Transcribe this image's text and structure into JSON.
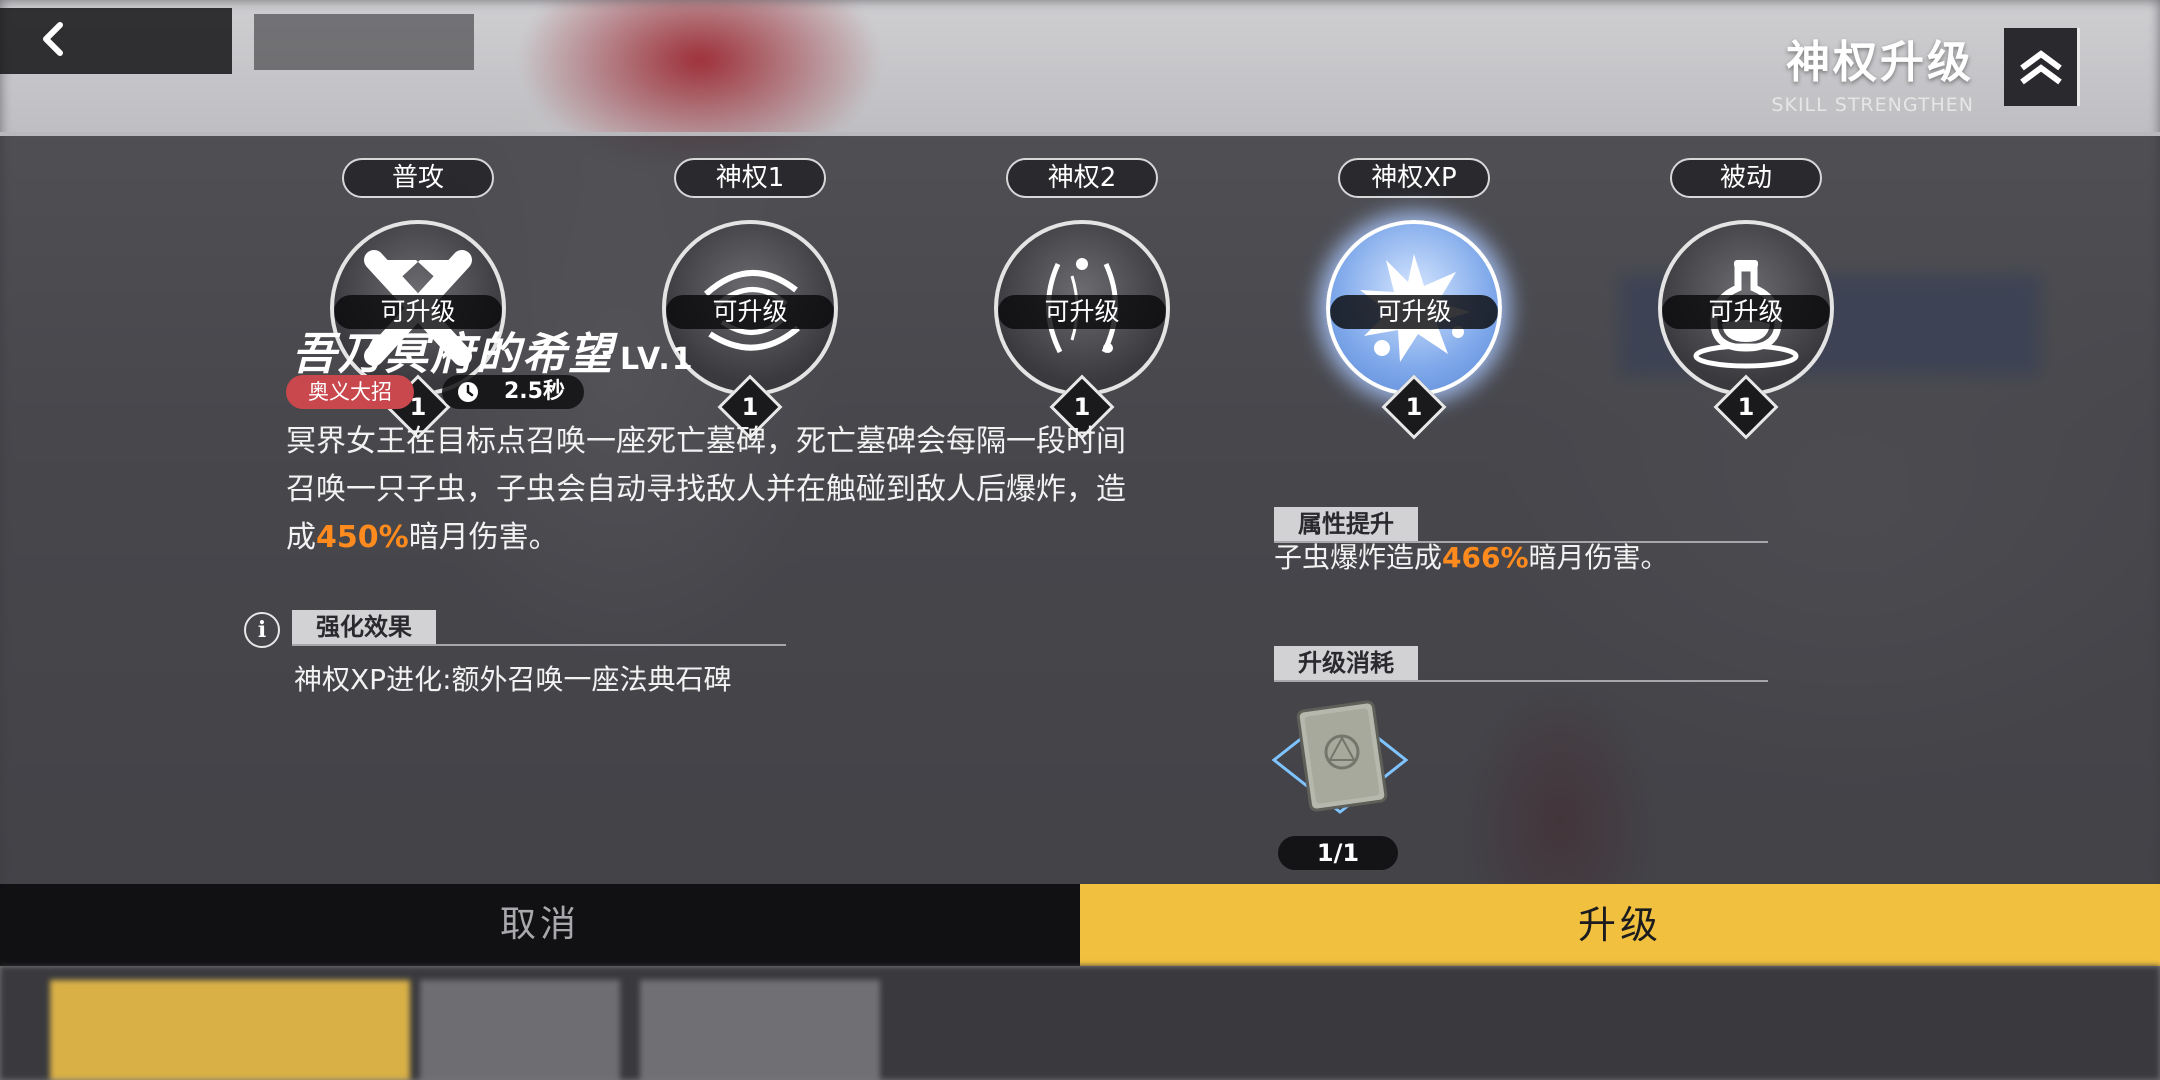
{
  "header": {
    "title": "神权升级",
    "subtitle": "SKILL STRENGTHEN",
    "back_icon": "chevron-left-icon",
    "rank_icon": "double-chevron-up-icon"
  },
  "skills": [
    {
      "tab": "普攻",
      "status": "可升级",
      "level": "1",
      "icon": "cross-slash-icon",
      "active": false
    },
    {
      "tab": "神权1",
      "status": "可升级",
      "level": "1",
      "icon": "vortex-icon",
      "active": false
    },
    {
      "tab": "神权2",
      "status": "可升级",
      "level": "1",
      "icon": "spiral-burst-icon",
      "active": false
    },
    {
      "tab": "神权XP",
      "status": "可升级",
      "level": "1",
      "icon": "explosion-icon",
      "active": true
    },
    {
      "tab": "被动",
      "status": "可升级",
      "level": "1",
      "icon": "flask-icon",
      "active": false
    }
  ],
  "detail": {
    "name": "吾乃冥府的希望",
    "level": "LV.1",
    "tag": "奥义大招",
    "cooldown": "2.5秒",
    "desc_part1": "冥界女王在目标点召唤一座死亡墓碑，死亡墓碑会每隔一段时间召唤一只子虫，子虫会自动寻找敌人并在触碰到敌人后爆炸，造成",
    "desc_value": "450%",
    "desc_part2": "暗月伤害。"
  },
  "enhance": {
    "header": "强化效果",
    "text": "神权XP进化:额外召唤一座法典石碑"
  },
  "attributes": {
    "header": "属性提升",
    "part1": "子虫爆炸造成",
    "value": "466%",
    "part2": "暗月伤害。"
  },
  "cost": {
    "header": "升级消耗",
    "item_icon": "tome-icon",
    "count": "1/1"
  },
  "buttons": {
    "cancel": "取消",
    "upgrade": "升级"
  },
  "colors": {
    "accent_yellow": "#f0c03e",
    "highlight_orange": "#ff8a1e",
    "ult_tag_red": "#c9484d"
  }
}
